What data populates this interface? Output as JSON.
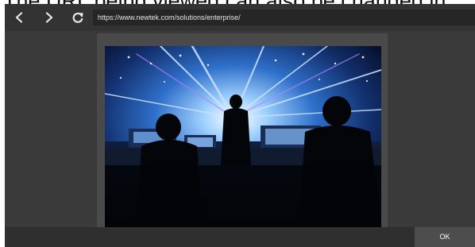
{
  "caption": {
    "text": "The URL being viewed can also be changed in"
  },
  "browser": {
    "back_icon": "chevron-left-icon",
    "forward_icon": "chevron-right-icon",
    "refresh_icon": "refresh-icon",
    "url": "https://www.newtek.com/solutions/enterprise/"
  },
  "content": {
    "image": "concert-control-room-photo"
  },
  "footer": {
    "ok_label": "OK"
  },
  "colors": {
    "dialog_background": "#3a3a3a",
    "toolbar_background": "#333333",
    "address_background": "#262626",
    "icon_color": "#e8e8e8"
  }
}
